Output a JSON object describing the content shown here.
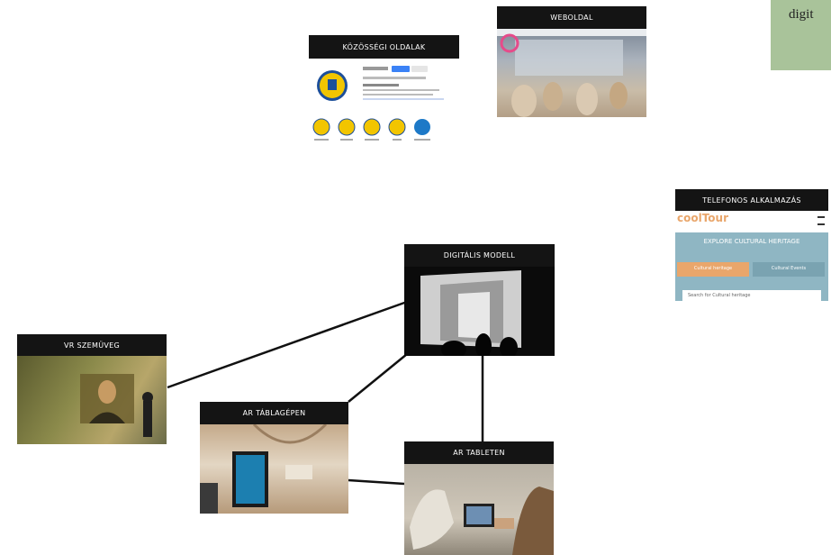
{
  "note": {
    "text": "digit"
  },
  "nodes": {
    "social": {
      "title": "KÖZÖSSÉGI OLDALAK"
    },
    "web": {
      "title": "WEBOLDAL"
    },
    "app": {
      "title": "TELEFONOS ALKALMAZÁS"
    },
    "model": {
      "title": "DIGITÁLIS MODELL"
    },
    "vr": {
      "title": "VR SZEMÜVEG"
    },
    "arscreen": {
      "title": "AR TÁBLAGÉPEN"
    },
    "artablet": {
      "title": "AR TABLETEN"
    }
  },
  "app_screen": {
    "brand": "coolTour",
    "hero": "EXPLORE CULTURAL HERITAGE",
    "tab_left": "Cultural heritage",
    "tab_right": "Cultural Events",
    "search": "Search for Cultural heritage"
  },
  "links": [
    [
      "vr",
      "model"
    ],
    [
      "arscreen",
      "model"
    ],
    [
      "artablet",
      "model"
    ],
    [
      "arscreen",
      "artablet"
    ]
  ],
  "colors": {
    "header": "#141414",
    "note": "#a9c39a",
    "link": "#111111",
    "social_accent": "#f2c500",
    "app_accent": "#e9a66b"
  }
}
